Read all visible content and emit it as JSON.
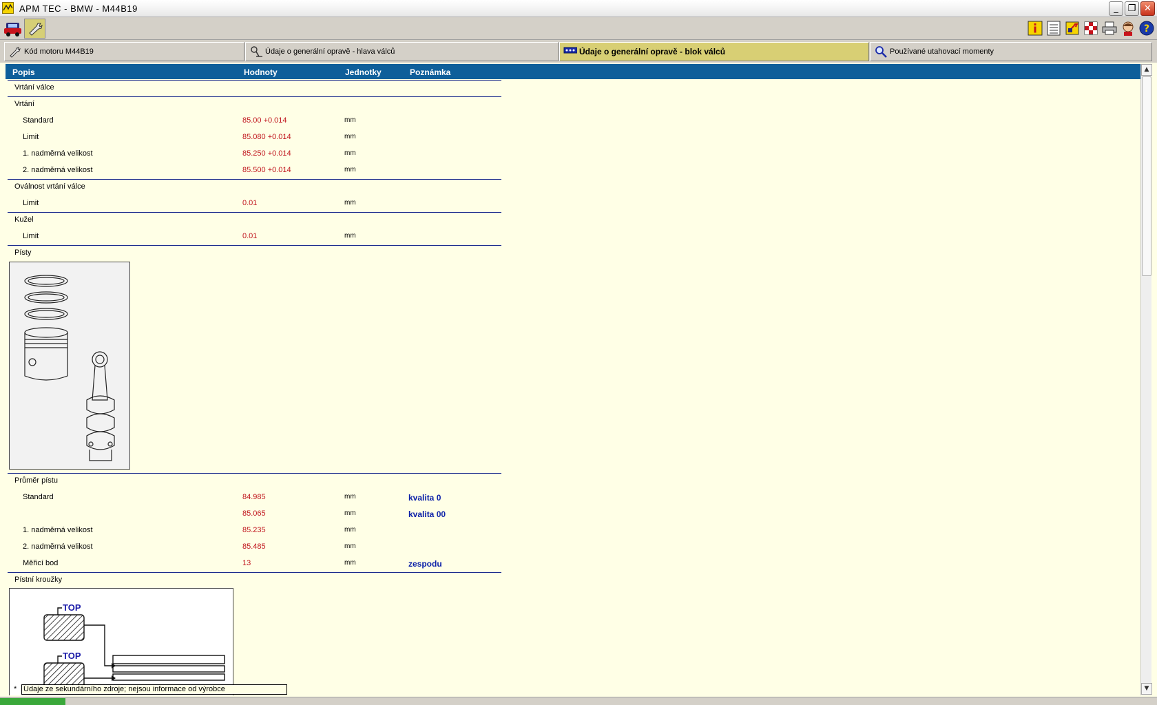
{
  "window": {
    "title": "APM TEC - BMW - M44B19",
    "minimize_glyph": "_",
    "restore_glyph": "❐",
    "close_glyph": "✕"
  },
  "toolbar": {
    "left_icons": [
      "car-icon",
      "wrench-icon"
    ],
    "right_icons": [
      "info-icon",
      "list-icon",
      "tools-icon",
      "flag-icon",
      "print-icon",
      "person-icon",
      "help-icon"
    ]
  },
  "tabs": [
    {
      "label": "Kód motoru M44B19",
      "icon": "wrench-icon"
    },
    {
      "label": "Údaje o generální opravě - hlava válců",
      "icon": "valve-icon"
    },
    {
      "label": "Údaje o generální opravě - blok válců",
      "icon": "engine-block-icon"
    },
    {
      "label": "Používané utahovací momenty",
      "icon": "magnifier-icon"
    }
  ],
  "columns": {
    "desc": "Popis",
    "val": "Hodnoty",
    "unit": "Jednotky",
    "note": "Poznámka"
  },
  "rows": [
    {
      "desc": "Vrtání válce"
    },
    {
      "desc": "Vrtání"
    },
    {
      "desc": "Standard",
      "val": "85.00 +0.014",
      "unit": "mm"
    },
    {
      "desc": "Limit",
      "val": "85.080 +0.014",
      "unit": "mm"
    },
    {
      "desc": "1. nadměrná velikost",
      "val": "85.250 +0.014",
      "unit": "mm"
    },
    {
      "desc": "2. nadměrná velikost",
      "val": "85.500 +0.014",
      "unit": "mm"
    },
    {
      "desc": "Oválnost vrtání válce"
    },
    {
      "desc": "Limit",
      "val": "0.01",
      "unit": "mm"
    },
    {
      "desc": "Kužel"
    },
    {
      "desc": "Limit",
      "val": "0.01",
      "unit": "mm"
    },
    {
      "desc": "Písty"
    },
    {
      "desc": "Průměr pístu"
    },
    {
      "desc": "Standard",
      "val": "84.985",
      "unit": "mm",
      "note": "kvalita 0"
    },
    {
      "desc": "",
      "val": "85.065",
      "unit": "mm",
      "note": "kvalita 00"
    },
    {
      "desc": "1. nadměrná velikost",
      "val": "85.235",
      "unit": "mm"
    },
    {
      "desc": "2. nadměrná velikost",
      "val": "85.485",
      "unit": "mm"
    },
    {
      "desc": "Měřicí bod",
      "val": "13",
      "unit": "mm",
      "note": "zespodu"
    },
    {
      "desc": "Pístní kroužky"
    }
  ],
  "figure_rings": {
    "label_top_1": "TOP",
    "label_top_2": "TOP"
  },
  "footnote": {
    "star": "*",
    "text": "Údaje ze sekundárního zdroje; nejsou informace od výrobce"
  },
  "scrollbar": {
    "up_glyph": "▲",
    "down_glyph": "▼"
  }
}
